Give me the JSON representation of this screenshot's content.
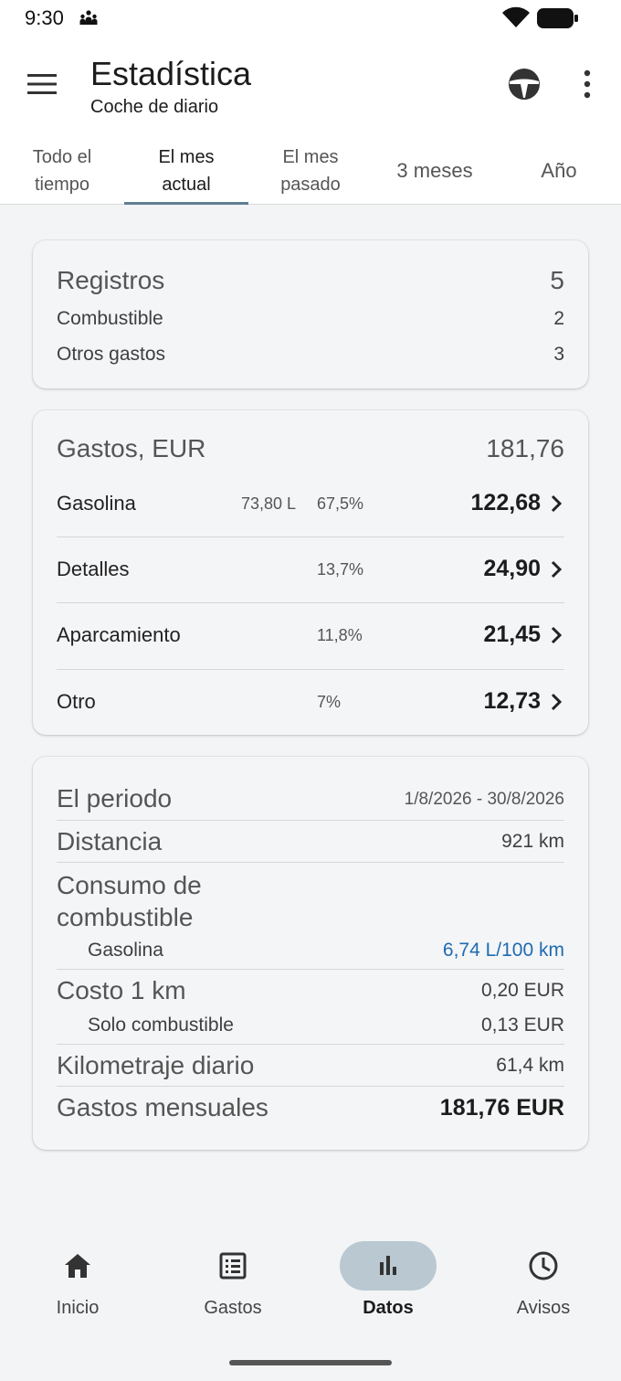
{
  "status_bar": {
    "time": "9:30"
  },
  "header": {
    "title": "Estadística",
    "subtitle": "Coche de diario"
  },
  "tabs": [
    {
      "label": "Todo el\ntiempo",
      "active": false
    },
    {
      "label": "El mes\nactual",
      "active": true
    },
    {
      "label": "El mes\npasado",
      "active": false
    },
    {
      "label": "3 meses",
      "active": false
    },
    {
      "label": "Año",
      "active": false
    }
  ],
  "records": {
    "title": "Registros",
    "total": "5",
    "rows": [
      {
        "label": "Combustible",
        "value": "2"
      },
      {
        "label": "Otros gastos",
        "value": "3"
      }
    ]
  },
  "expenses": {
    "title": "Gastos, EUR",
    "total": "181,76",
    "rows": [
      {
        "name": "Gasolina",
        "liters": "73,80 L",
        "percent": "67,5%",
        "amount": "122,68"
      },
      {
        "name": "Detalles",
        "liters": "",
        "percent": "13,7%",
        "amount": "24,90"
      },
      {
        "name": "Aparcamiento",
        "liters": "",
        "percent": "11,8%",
        "amount": "21,45"
      },
      {
        "name": "Otro",
        "liters": "",
        "percent": "7%",
        "amount": "12,73"
      }
    ]
  },
  "period": {
    "title": "El periodo",
    "range": "1/8/2026 - 30/8/2026",
    "distance_label": "Distancia",
    "distance_value": "921 km",
    "consumption_label": "Consumo de\ncombustible",
    "consumption_fuel_label": "Gasolina",
    "consumption_fuel_value": "6,74 L/100 km",
    "cost_label": "Costo 1 km",
    "cost_value": "0,20 EUR",
    "fuel_only_label": "Solo combustible",
    "fuel_only_value": "0,13 EUR",
    "daily_label": "Kilometraje diario",
    "daily_value": "61,4 km",
    "monthly_label": "Gastos mensuales",
    "monthly_value": "181,76 EUR"
  },
  "bottom_nav": [
    {
      "label": "Inicio",
      "icon": "home-icon",
      "active": false
    },
    {
      "label": "Gastos",
      "icon": "list-icon",
      "active": false
    },
    {
      "label": "Datos",
      "icon": "bar-chart-icon",
      "active": true
    },
    {
      "label": "Avisos",
      "icon": "clock-icon",
      "active": false
    }
  ],
  "colors": {
    "accent": "#5f7f92",
    "nav_active_pill": "#b9c8d1",
    "link_blue": "#1f6bb0"
  }
}
